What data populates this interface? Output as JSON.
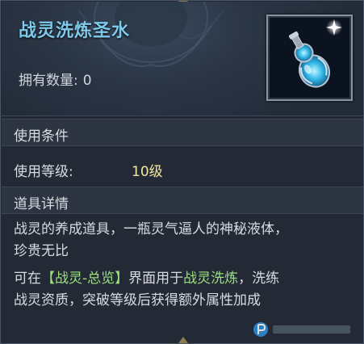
{
  "item": {
    "name": "战灵洗炼圣水",
    "owned_label": "拥有数量:",
    "owned_value": "0"
  },
  "conditions": {
    "header": "使用条件",
    "level_label": "使用等级:",
    "level_value": "10级"
  },
  "details": {
    "header": "道具详情",
    "line1": "战灵的养成道具，一瓶灵气逼人的神秘液体，",
    "line2": "珍贵无比",
    "line3_prefix": "可在",
    "line3_link": "【战灵-总览】",
    "line3_mid": "界面用于",
    "line3_highlight": "战灵洗炼",
    "line3_suffix": "，洗练",
    "line4": "战灵资质，突破等级后获得额外属性加成"
  },
  "colors": {
    "title": "#7ec8ea",
    "highlight_green": "#9be07e",
    "level_value": "#f0e6a0",
    "text": "#d8dbe0"
  },
  "icons": {
    "item": "potion-bottle-icon",
    "watermark": "site-logo-icon"
  }
}
